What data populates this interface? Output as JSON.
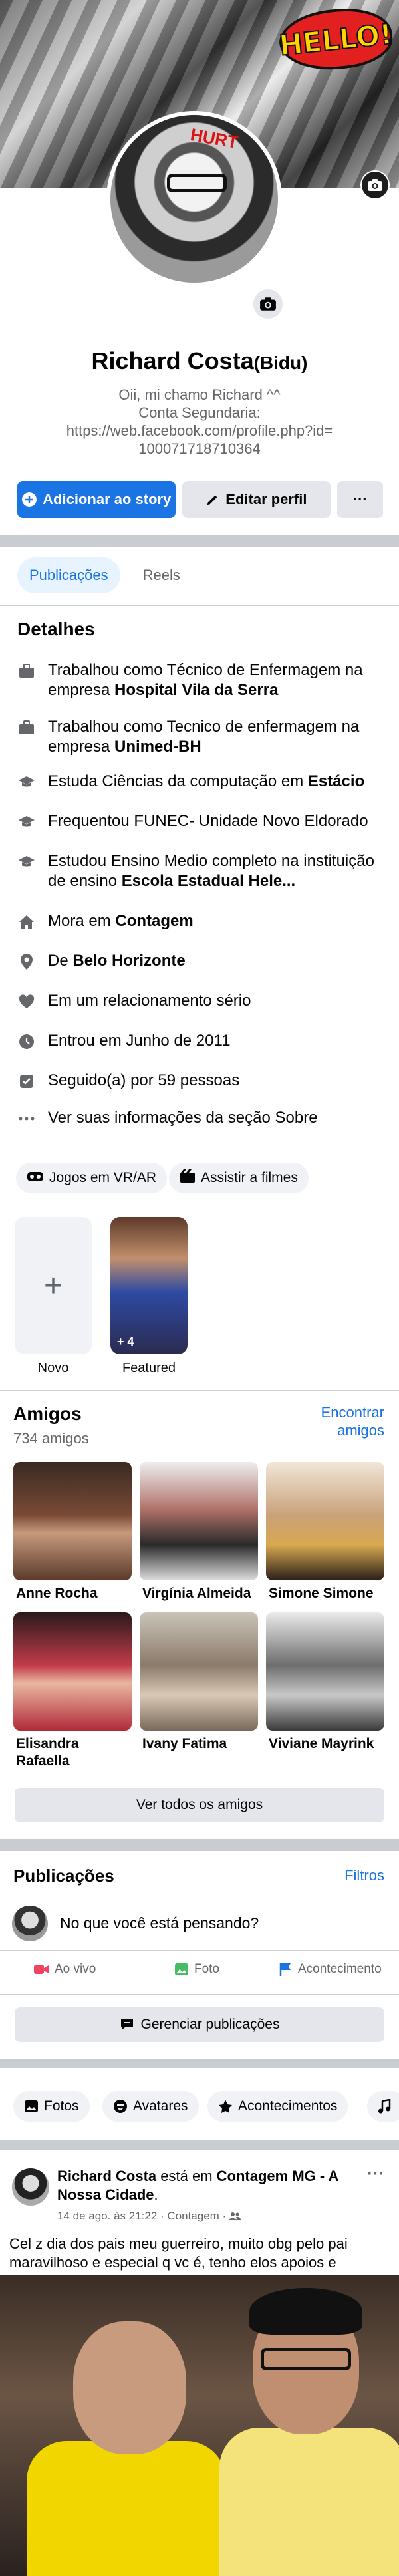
{
  "cover": {
    "badge_text": "HELLO!",
    "graffiti_text": "HURT"
  },
  "profile": {
    "name": "Richard Costa",
    "nickname": "(Bidu)",
    "bio_line1": "Oii, mi chamo Richard ^^",
    "bio_line2": "Conta Segundaria:",
    "bio_line3": "https://web.facebook.com/profile.php?id=",
    "bio_line4": "100071718710364"
  },
  "actions": {
    "add_story": "Adicionar ao story",
    "edit_profile": "Editar perfil",
    "more": "···"
  },
  "tabs": [
    {
      "label": "Publicações",
      "active": true
    },
    {
      "label": "Reels",
      "active": false
    }
  ],
  "details": {
    "heading": "Detalhes",
    "items": [
      {
        "icon": "briefcase-icon",
        "text": "Trabalhou como Técnico de Enfermagem na empresa ",
        "bold": "Hospital Vila da Serra"
      },
      {
        "icon": "briefcase-icon",
        "text": "Trabalhou como Tecnico de enfermagem na empresa ",
        "bold": "Unimed-BH"
      },
      {
        "icon": "graduation-cap-icon",
        "text": "Estuda Ciências da computação em ",
        "bold": "Estácio"
      },
      {
        "icon": "graduation-cap-icon",
        "text": "Frequentou FUNEC- Unidade Novo Eldorado",
        "bold": ""
      },
      {
        "icon": "graduation-cap-icon",
        "text": "Estudou Ensino Medio completo na instituição de ensino ",
        "bold": "Escola Estadual Hele..."
      },
      {
        "icon": "home-icon",
        "text": "Mora em ",
        "bold": "Contagem"
      },
      {
        "icon": "location-pin-icon",
        "text": "De ",
        "bold": "Belo Horizonte"
      },
      {
        "icon": "heart-icon",
        "text": "Em um relacionamento sério",
        "bold": ""
      },
      {
        "icon": "clock-icon",
        "text": "Entrou em Junho de 2011",
        "bold": ""
      },
      {
        "icon": "followers-icon",
        "text": "Seguido(a) por 59 pessoas",
        "bold": ""
      },
      {
        "icon": "ellipsis-icon",
        "text": "Ver suas informações da seção Sobre",
        "bold": ""
      }
    ]
  },
  "hobbies": [
    {
      "icon": "vr-icon",
      "label": "Jogos em VR/AR"
    },
    {
      "icon": "film-icon",
      "label": "Assistir a filmes"
    }
  ],
  "highlights": [
    {
      "label": "Novo"
    },
    {
      "label": "Featured",
      "count": "+ 4"
    }
  ],
  "friends": {
    "heading": "Amigos",
    "count": "734 amigos",
    "find": "Encontrar amigos",
    "list": [
      {
        "name": "Anne Rocha",
        "color": "#7a4a36"
      },
      {
        "name": "Virgínia Almeida",
        "color": "#b0726a"
      },
      {
        "name": "Simone Simone",
        "color": "#caa27a"
      },
      {
        "name": "Elisandra Rafaella",
        "color": "#c23b4a"
      },
      {
        "name": "Ivany Fatima",
        "color": "#8c7a6b"
      },
      {
        "name": "Viviane Mayrink",
        "color": "#6d6d6d"
      }
    ],
    "see_all": "Ver todos os amigos"
  },
  "posts_section": {
    "heading": "Publicações",
    "filters": "Filtros",
    "composer_placeholder": "No que você está pensando?",
    "live": "Ao vivo",
    "photo": "Foto",
    "event": "Acontecimento",
    "manage": "Gerenciar publicações"
  },
  "filter_chips": [
    {
      "icon": "photos-icon",
      "label": "Fotos"
    },
    {
      "icon": "avatar-icon",
      "label": "Avatares"
    },
    {
      "icon": "star-icon",
      "label": "Acontecimentos"
    },
    {
      "icon": "music-icon",
      "label": ""
    }
  ],
  "post": {
    "author": "Richard Costa",
    "mid": " está em ",
    "place": "Contagem MG - A Nossa Cidade",
    "place_end": ".",
    "meta": "14 de ago. às 21:22 · Contagem · ",
    "more": "···",
    "text": "Cel z dia dos pais meu guerreiro, muito obg pelo pai maravilhoso e especial q vc é, tenho elos apoios e momentos engraçados, tenho muito orgulho da pessoa q vc é e por vc ser meu pai, feliz dia dos pais ❤️❤️❤️"
  }
}
